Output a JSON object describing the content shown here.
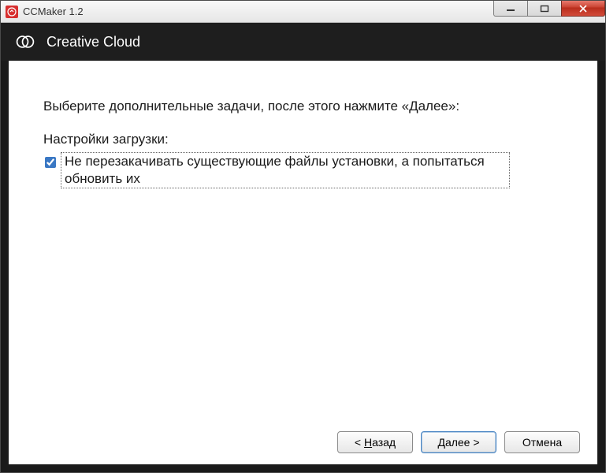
{
  "window": {
    "title": "CCMaker 1.2"
  },
  "banner": {
    "title": "Creative Cloud"
  },
  "main": {
    "instruction": "Выберите дополнительные задачи, после этого нажмите «Далее»:",
    "section_label": "Настройки загрузки:",
    "checkbox": {
      "checked": true,
      "label": "Не перезакачивать существующие файлы установки, а попытаться обновить их"
    }
  },
  "buttons": {
    "back_prefix": "< ",
    "back_u": "Н",
    "back_rest": "азад",
    "next_u": "Д",
    "next_rest": "алее >",
    "cancel": "Отмена"
  }
}
